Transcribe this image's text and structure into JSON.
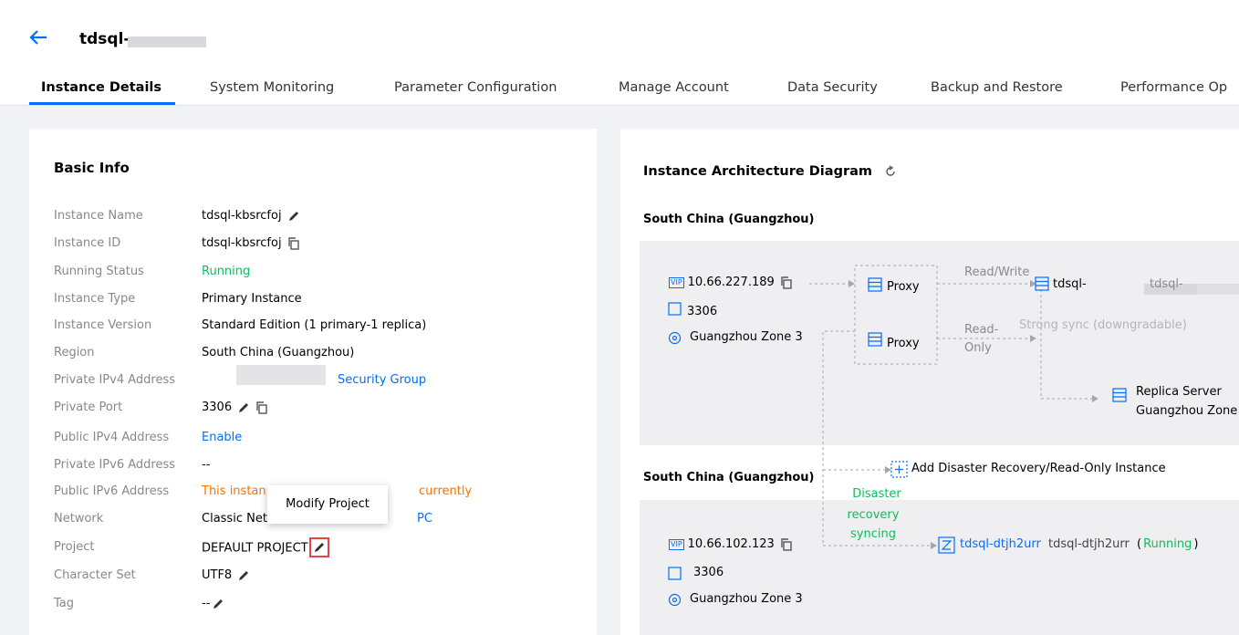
{
  "header": {
    "title": "tdsql-",
    "tabs": [
      "Instance Details",
      "System Monitoring",
      "Parameter Configuration",
      "Manage Account",
      "Data Security",
      "Backup and Restore",
      "Performance Op"
    ]
  },
  "basic_info": {
    "title": "Basic Info",
    "rows": [
      {
        "label": "Instance Name",
        "value": "tdsql-kbsrcfoj"
      },
      {
        "label": "Instance ID",
        "value": "tdsql-kbsrcfoj"
      },
      {
        "label": "Running Status",
        "value": "Running"
      },
      {
        "label": "Instance Type",
        "value": "Primary Instance"
      },
      {
        "label": "Instance Version",
        "value": "Standard Edition  (1 primary-1 replica)"
      },
      {
        "label": "Region",
        "value": "South China (Guangzhou)"
      },
      {
        "label": "Private IPv4 Address",
        "value": "Security Group"
      },
      {
        "label": "Private Port",
        "value": "3306"
      },
      {
        "label": "Public IPv4 Address",
        "value": "Enable"
      },
      {
        "label": "Private IPv6 Address",
        "value": "--"
      },
      {
        "label": "Public IPv6 Address",
        "value": "This instan",
        "value2": "currently"
      },
      {
        "label": "Network",
        "value": "Classic Net",
        "value2": "PC"
      },
      {
        "label": "Project",
        "value": "DEFAULT PROJECT"
      },
      {
        "label": "Character Set",
        "value": "UTF8"
      },
      {
        "label": "Tag",
        "value": "--"
      }
    ],
    "tooltip": "Modify Project"
  },
  "diagram": {
    "title": "Instance Architecture Diagram",
    "primary": {
      "region": "South China (Guangzhou)",
      "vip_badge": "VIP",
      "vip": "10.66.227.189",
      "port": "3306",
      "zone": "Guangzhou Zone 3",
      "proxy1": "Proxy",
      "proxy2": "Proxy",
      "rw_label": "Read/Write",
      "ro_label_1": "Read-",
      "ro_label_2": "Only",
      "instance_name": "tdsql-",
      "instance_name2": "tdsql-",
      "sync_label": "Strong sync (downgradable)",
      "replica_label": "Replica Server",
      "replica_zone": "Guangzhou Zone"
    },
    "add_link": "Add Disaster Recovery/Read-Only Instance",
    "dr": {
      "region": "South China (Guangzhou)",
      "sync_label_1": "Disaster",
      "sync_label_2": "recovery",
      "sync_label_3": "syncing",
      "vip_badge": "VIP",
      "vip": "10.66.102.123",
      "port": "3306",
      "zone": "Guangzhou Zone 3",
      "instance_id": "tdsql-dtjh2urr",
      "instance_name": "tdsql-dtjh2urr",
      "status_open": "(",
      "status": "Running",
      "status_close": ")"
    }
  },
  "colors": {
    "accent": "#006eff",
    "running": "#0abf5b",
    "warning": "#ff7200",
    "highlight": "#e54545"
  }
}
